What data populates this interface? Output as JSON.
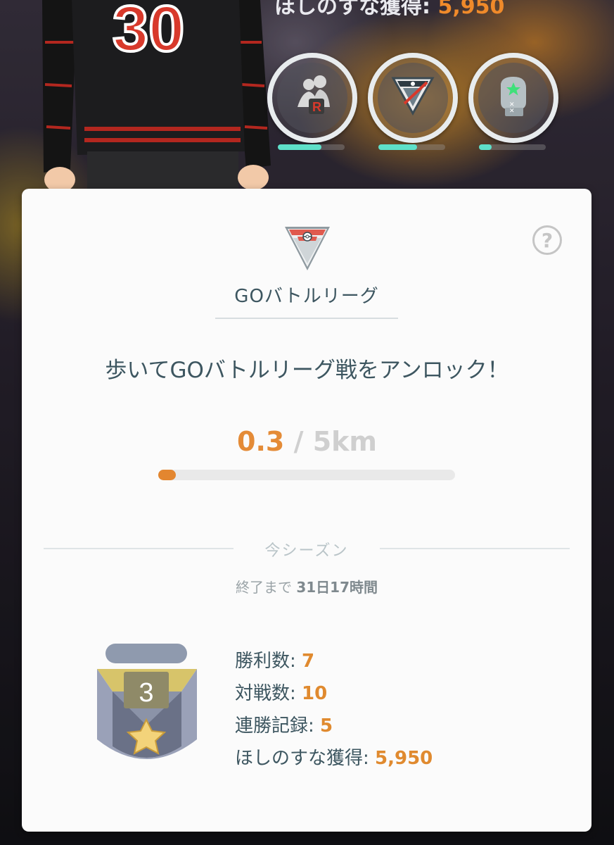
{
  "header": {
    "stardust_label": "ほしのすな獲得:",
    "stardust_value": "5,950"
  },
  "league_buttons": [
    {
      "name": "team-go-rocket",
      "icon": "rocket-grunt-icon",
      "progress": 0.65
    },
    {
      "name": "go-battle-league",
      "icon": "battle-league-icon",
      "progress": 0.5
    },
    {
      "name": "training",
      "icon": "boxing-glove-icon",
      "progress": 0.2
    }
  ],
  "card": {
    "help_icon": "?",
    "league_name": "GOバトルリーグ",
    "unlock_message": "歩いてGOバトルリーグ戦をアンロック！",
    "distance_current": "0.3",
    "distance_separator": "/",
    "distance_total": "5km",
    "distance_progress": 0.06,
    "season_label": "今シーズン",
    "season_remaining_prefix": "終了まで",
    "season_remaining_value": "31日17時間",
    "rank_number": "3",
    "stats": [
      {
        "label": "勝利数:",
        "value": "7"
      },
      {
        "label": "対戦数:",
        "value": "10"
      },
      {
        "label": "連勝記録:",
        "value": "5"
      },
      {
        "label": "ほしのすな獲得:",
        "value": "5,950"
      }
    ]
  },
  "colors": {
    "accent_orange": "#e48b37",
    "progress_teal": "#5ee0c9",
    "text_dark": "#3d5660"
  }
}
